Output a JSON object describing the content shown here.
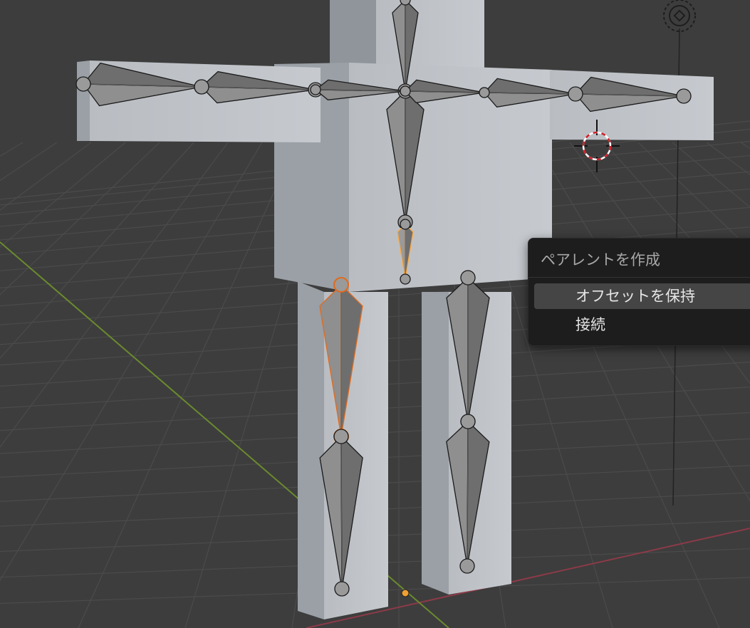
{
  "menu": {
    "title": "ペアレントを作成",
    "items": [
      {
        "label": "オフセットを保持",
        "highlighted": true
      },
      {
        "label": "接続",
        "highlighted": false
      }
    ]
  },
  "colors": {
    "background": "#3d3d3d",
    "grid": "#4a4a4a",
    "x_axis": "#8c3a48",
    "y_axis": "#6a8a2e",
    "mesh": "#bfc3c8",
    "bone": "#8c8c8c",
    "selected_active": "#ffaa40",
    "selected": "#e26a1c",
    "menu_bg": "#1d1d1d",
    "menu_highlight": "#454545"
  },
  "icons": [
    "3d-cursor-icon",
    "light-object-icon",
    "origin-dot-icon"
  ]
}
